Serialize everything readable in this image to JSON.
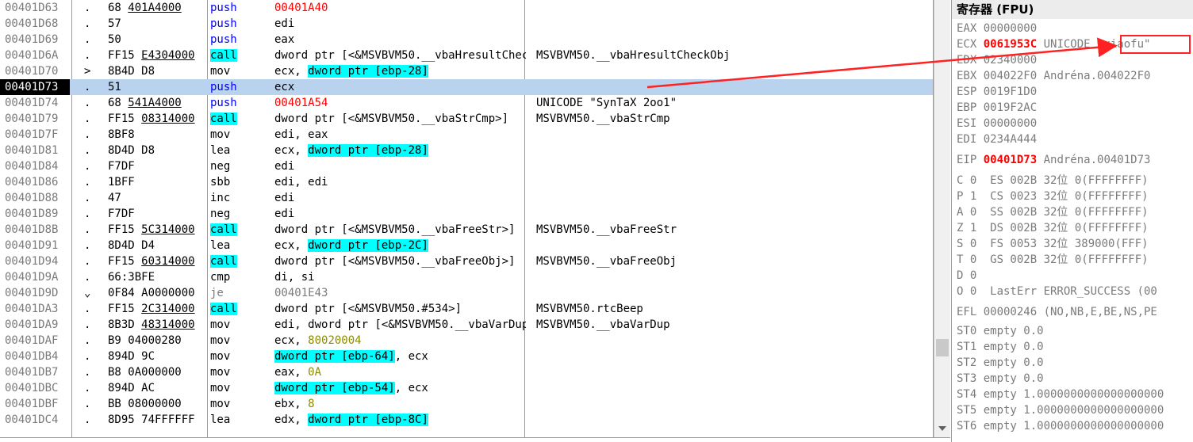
{
  "disasm": {
    "rows": [
      {
        "addr": "00401D63",
        "mark": ".",
        "hex_fix": "68 401A4000",
        "hex_rest": "",
        "mn": "push",
        "mn_type": "push",
        "ops": [
          {
            "t": "00401A40",
            "c": "addr"
          }
        ],
        "comment": ""
      },
      {
        "addr": "00401D68",
        "mark": ".",
        "hex_fix": "",
        "hex_rest": "57",
        "mn": "push",
        "mn_type": "push",
        "ops": [
          {
            "t": "edi",
            "c": ""
          }
        ],
        "comment": ""
      },
      {
        "addr": "00401D69",
        "mark": ".",
        "hex_fix": "",
        "hex_rest": "50",
        "mn": "push",
        "mn_type": "push",
        "ops": [
          {
            "t": "eax",
            "c": ""
          }
        ],
        "comment": ""
      },
      {
        "addr": "00401D6A",
        "mark": ".",
        "hex_fix": "FF15 E4304000",
        "hex_rest": "",
        "mn": "call",
        "mn_type": "call",
        "ops": [
          {
            "t": "dword ptr [<&MSVBVM50.__vbaHresultCheckObj>]",
            "c": ""
          }
        ],
        "comment": "MSVBVM50.__vbaHresultCheckObj"
      },
      {
        "addr": "00401D70",
        "mark": ">",
        "hex_fix": "",
        "hex_rest": "8B4D D8",
        "mn": "mov",
        "mn_type": "plain",
        "ops": [
          {
            "t": "ecx, ",
            "c": ""
          },
          {
            "t": "dword ptr [ebp-28]",
            "c": "mem"
          }
        ],
        "comment": ""
      },
      {
        "addr": "00401D73",
        "mark": ".",
        "hex_fix": "",
        "hex_rest": "51",
        "mn": "push",
        "mn_type": "push",
        "ops": [
          {
            "t": "ecx",
            "c": ""
          }
        ],
        "comment": "",
        "selected": true
      },
      {
        "addr": "00401D74",
        "mark": ".",
        "hex_fix": "68 541A4000",
        "hex_rest": "",
        "mn": "push",
        "mn_type": "push",
        "ops": [
          {
            "t": "00401A54",
            "c": "addr"
          }
        ],
        "comment": "UNICODE \"SynTaX 2oo1\""
      },
      {
        "addr": "00401D79",
        "mark": ".",
        "hex_fix": "FF15 08314000",
        "hex_rest": "",
        "mn": "call",
        "mn_type": "call",
        "ops": [
          {
            "t": "dword ptr [<&MSVBVM50.__vbaStrCmp>]",
            "c": ""
          }
        ],
        "comment": "MSVBVM50.__vbaStrCmp"
      },
      {
        "addr": "00401D7F",
        "mark": ".",
        "hex_fix": "",
        "hex_rest": "8BF8",
        "mn": "mov",
        "mn_type": "plain",
        "ops": [
          {
            "t": "edi, eax",
            "c": ""
          }
        ],
        "comment": ""
      },
      {
        "addr": "00401D81",
        "mark": ".",
        "hex_fix": "",
        "hex_rest": "8D4D D8",
        "mn": "lea",
        "mn_type": "plain",
        "ops": [
          {
            "t": "ecx, ",
            "c": ""
          },
          {
            "t": "dword ptr [ebp-28]",
            "c": "mem"
          }
        ],
        "comment": ""
      },
      {
        "addr": "00401D84",
        "mark": ".",
        "hex_fix": "",
        "hex_rest": "F7DF",
        "mn": "neg",
        "mn_type": "plain",
        "ops": [
          {
            "t": "edi",
            "c": ""
          }
        ],
        "comment": ""
      },
      {
        "addr": "00401D86",
        "mark": ".",
        "hex_fix": "",
        "hex_rest": "1BFF",
        "mn": "sbb",
        "mn_type": "plain",
        "ops": [
          {
            "t": "edi, edi",
            "c": ""
          }
        ],
        "comment": ""
      },
      {
        "addr": "00401D88",
        "mark": ".",
        "hex_fix": "",
        "hex_rest": "47",
        "mn": "inc",
        "mn_type": "plain",
        "ops": [
          {
            "t": "edi",
            "c": ""
          }
        ],
        "comment": ""
      },
      {
        "addr": "00401D89",
        "mark": ".",
        "hex_fix": "",
        "hex_rest": "F7DF",
        "mn": "neg",
        "mn_type": "plain",
        "ops": [
          {
            "t": "edi",
            "c": ""
          }
        ],
        "comment": ""
      },
      {
        "addr": "00401D8B",
        "mark": ".",
        "hex_fix": "FF15 5C314000",
        "hex_rest": "",
        "mn": "call",
        "mn_type": "call",
        "ops": [
          {
            "t": "dword ptr [<&MSVBVM50.__vbaFreeStr>]",
            "c": ""
          }
        ],
        "comment": "MSVBVM50.__vbaFreeStr"
      },
      {
        "addr": "00401D91",
        "mark": ".",
        "hex_fix": "",
        "hex_rest": "8D4D D4",
        "mn": "lea",
        "mn_type": "plain",
        "ops": [
          {
            "t": "ecx, ",
            "c": ""
          },
          {
            "t": "dword ptr [ebp-2C]",
            "c": "mem"
          }
        ],
        "comment": ""
      },
      {
        "addr": "00401D94",
        "mark": ".",
        "hex_fix": "FF15 60314000",
        "hex_rest": "",
        "mn": "call",
        "mn_type": "call",
        "ops": [
          {
            "t": "dword ptr [<&MSVBVM50.__vbaFreeObj>]",
            "c": ""
          }
        ],
        "comment": "MSVBVM50.__vbaFreeObj"
      },
      {
        "addr": "00401D9A",
        "mark": ".",
        "hex_fix": "",
        "hex_rest": "66:3BFE",
        "mn": "cmp",
        "mn_type": "plain",
        "ops": [
          {
            "t": "di, si",
            "c": ""
          }
        ],
        "comment": ""
      },
      {
        "addr": "00401D9D",
        "mark": "⌄",
        "hex_fix": "",
        "hex_rest": "0F84 A0000000",
        "mn": "je",
        "mn_type": "je",
        "ops": [
          {
            "t": "00401E43",
            "c": "memc"
          }
        ],
        "comment": ""
      },
      {
        "addr": "00401DA3",
        "mark": ".",
        "hex_fix": "FF15 2C314000",
        "hex_rest": "",
        "mn": "call",
        "mn_type": "call",
        "ops": [
          {
            "t": "dword ptr [<&MSVBVM50.#534>]",
            "c": ""
          }
        ],
        "comment": "MSVBVM50.rtcBeep"
      },
      {
        "addr": "00401DA9",
        "mark": ".",
        "hex_fix": "8B3D 48314000",
        "hex_rest": "",
        "mn": "mov",
        "mn_type": "plain",
        "ops": [
          {
            "t": "edi, dword ptr [<&MSVBVM50.__vbaVarDup>]",
            "c": ""
          }
        ],
        "comment": "MSVBVM50.__vbaVarDup"
      },
      {
        "addr": "00401DAF",
        "mark": ".",
        "hex_fix": "",
        "hex_rest": "B9 04000280",
        "mn": "mov",
        "mn_type": "plain",
        "ops": [
          {
            "t": "ecx, ",
            "c": ""
          },
          {
            "t": "80020004",
            "c": "imm"
          }
        ],
        "comment": ""
      },
      {
        "addr": "00401DB4",
        "mark": ".",
        "hex_fix": "",
        "hex_rest": "894D 9C",
        "mn": "mov",
        "mn_type": "plain",
        "ops": [
          {
            "t": "dword ptr [ebp-64]",
            "c": "mem"
          },
          {
            "t": ", ecx",
            "c": ""
          }
        ],
        "comment": ""
      },
      {
        "addr": "00401DB7",
        "mark": ".",
        "hex_fix": "",
        "hex_rest": "B8 0A000000",
        "mn": "mov",
        "mn_type": "plain",
        "ops": [
          {
            "t": "eax, ",
            "c": ""
          },
          {
            "t": "0A",
            "c": "imm"
          }
        ],
        "comment": ""
      },
      {
        "addr": "00401DBC",
        "mark": ".",
        "hex_fix": "",
        "hex_rest": "894D AC",
        "mn": "mov",
        "mn_type": "plain",
        "ops": [
          {
            "t": "dword ptr [ebp-54]",
            "c": "mem"
          },
          {
            "t": ", ecx",
            "c": ""
          }
        ],
        "comment": ""
      },
      {
        "addr": "00401DBF",
        "mark": ".",
        "hex_fix": "",
        "hex_rest": "BB 08000000",
        "mn": "mov",
        "mn_type": "plain",
        "ops": [
          {
            "t": "ebx, ",
            "c": ""
          },
          {
            "t": "8",
            "c": "imm"
          }
        ],
        "comment": ""
      },
      {
        "addr": "00401DC4",
        "mark": ".",
        "hex_fix": "",
        "hex_rest": "8D95 74FFFFFF",
        "mn": "lea",
        "mn_type": "plain",
        "ops": [
          {
            "t": "edx, ",
            "c": ""
          },
          {
            "t": "dword ptr [ebp-8C]",
            "c": "mem"
          }
        ],
        "comment": ""
      }
    ]
  },
  "registers": {
    "title": "寄存器 (FPU)",
    "gp": [
      {
        "name": "EAX",
        "value": "00000000",
        "sym": "",
        "hl": false
      },
      {
        "name": "ECX",
        "value": "0061953C",
        "sym": "UNICODE \"xiaofu\"",
        "hl": true
      },
      {
        "name": "EDX",
        "value": "02340000",
        "sym": "",
        "hl": false
      },
      {
        "name": "EBX",
        "value": "004022F0",
        "sym": "Andréna.004022F0",
        "hl": false
      },
      {
        "name": "ESP",
        "value": "0019F1D0",
        "sym": "",
        "hl": false
      },
      {
        "name": "EBP",
        "value": "0019F2AC",
        "sym": "",
        "hl": false
      },
      {
        "name": "ESI",
        "value": "00000000",
        "sym": "",
        "hl": false
      },
      {
        "name": "EDI",
        "value": "0234A444",
        "sym": "",
        "hl": false
      }
    ],
    "eip": {
      "name": "EIP",
      "value": "00401D73",
      "sym": "Andréna.00401D73"
    },
    "flags": [
      "C 0  ES 002B 32位 0(FFFFFFFF)",
      "P 1  CS 0023 32位 0(FFFFFFFF)",
      "A 0  SS 002B 32位 0(FFFFFFFF)",
      "Z 1  DS 002B 32位 0(FFFFFFFF)",
      "S 0  FS 0053 32位 389000(FFF)",
      "T 0  GS 002B 32位 0(FFFFFFFF)",
      "D 0",
      "O 0  LastErr ERROR_SUCCESS (00"
    ],
    "efl": "EFL 00000246 (NO,NB,E,BE,NS,PE",
    "fpu": [
      "ST0 empty 0.0",
      "ST1 empty 0.0",
      "ST2 empty 0.0",
      "ST3 empty 0.0",
      "ST4 empty 1.0000000000000000000",
      "ST5 empty 1.0000000000000000000",
      "ST6 empty 1.0000000000000000000"
    ]
  },
  "colors": {
    "selection": "#b9d3ee",
    "call_bg": "#00ffff",
    "push": "#0000ff",
    "address": "#ff0000",
    "immediate": "#8b8b00",
    "annotation": "#ff2222"
  }
}
